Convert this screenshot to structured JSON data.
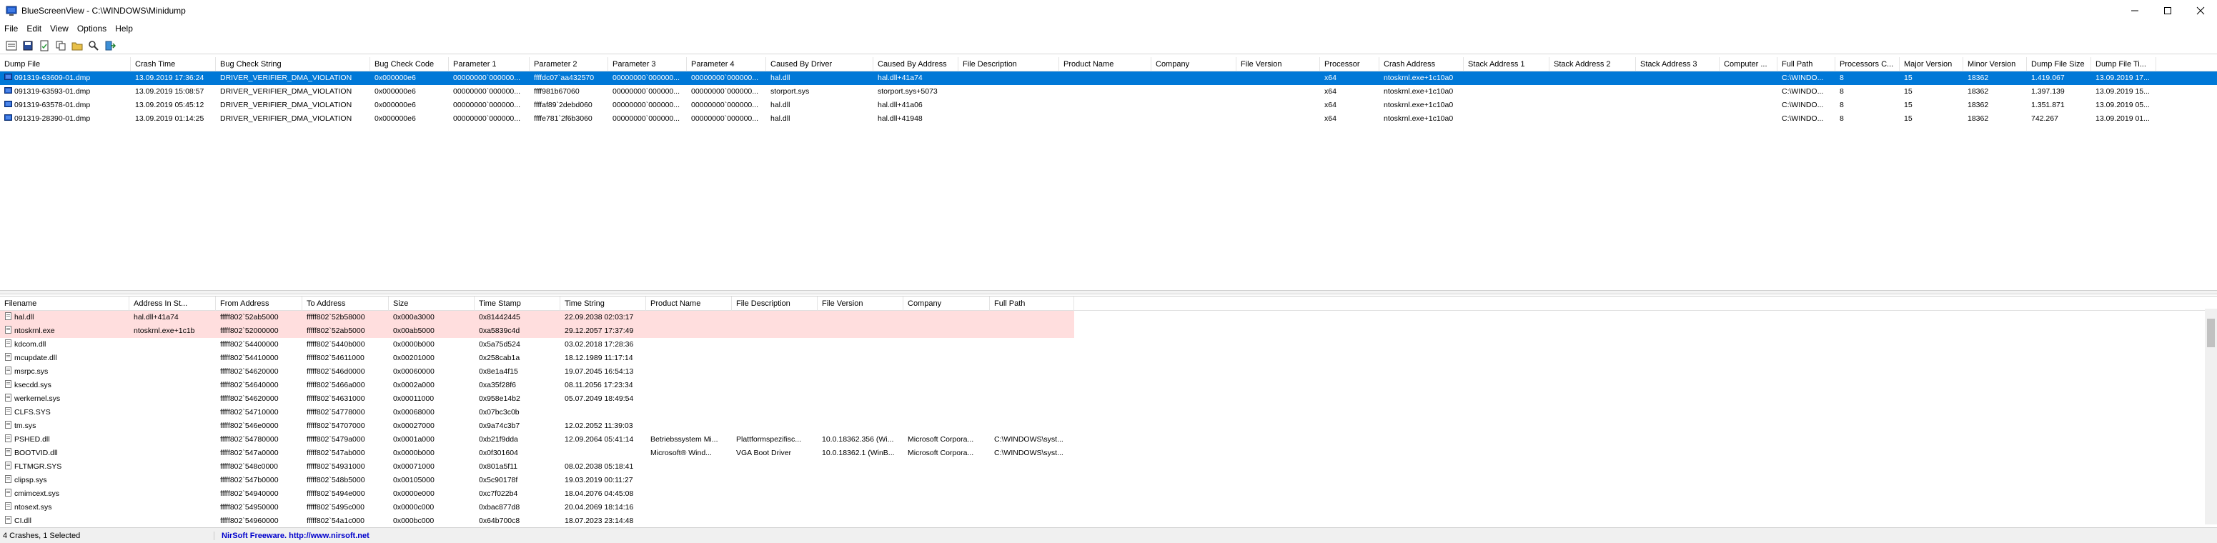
{
  "window": {
    "title": "BlueScreenView  -  C:\\WINDOWS\\Minidump"
  },
  "menu": [
    "File",
    "Edit",
    "View",
    "Options",
    "Help"
  ],
  "top_grid": {
    "columns": [
      "Dump File",
      "Crash Time",
      "Bug Check String",
      "Bug Check Code",
      "Parameter 1",
      "Parameter 2",
      "Parameter 3",
      "Parameter 4",
      "Caused By Driver",
      "Caused By Address",
      "File Description",
      "Product Name",
      "Company",
      "File Version",
      "Processor",
      "Crash Address",
      "Stack Address 1",
      "Stack Address 2",
      "Stack Address 3",
      "Computer ...",
      "Full Path",
      "Processors C...",
      "Major Version",
      "Minor Version",
      "Dump File Size",
      "Dump File Ti..."
    ],
    "rows": [
      [
        "091319-63609-01.dmp",
        "13.09.2019 17:36:24",
        "DRIVER_VERIFIER_DMA_VIOLATION",
        "0x000000e6",
        "00000000`000000...",
        "ffffdc07`aa432570",
        "00000000`000000...",
        "00000000`000000...",
        "hal.dll",
        "hal.dll+41a74",
        "",
        "",
        "",
        "",
        "x64",
        "ntoskrnl.exe+1c10a0",
        "",
        "",
        "",
        "",
        "C:\\WINDO...",
        "8",
        "15",
        "18362",
        "1.419.067",
        "13.09.2019 17..."
      ],
      [
        "091319-63593-01.dmp",
        "13.09.2019 15:08:57",
        "DRIVER_VERIFIER_DMA_VIOLATION",
        "0x000000e6",
        "00000000`000000...",
        "ffff981b67060",
        "00000000`000000...",
        "00000000`000000...",
        "storport.sys",
        "storport.sys+5073",
        "",
        "",
        "",
        "",
        "x64",
        "ntoskrnl.exe+1c10a0",
        "",
        "",
        "",
        "",
        "C:\\WINDO...",
        "8",
        "15",
        "18362",
        "1.397.139",
        "13.09.2019 15..."
      ],
      [
        "091319-63578-01.dmp",
        "13.09.2019 05:45:12",
        "DRIVER_VERIFIER_DMA_VIOLATION",
        "0x000000e6",
        "00000000`000000...",
        "ffffaf89`2debd060",
        "00000000`000000...",
        "00000000`000000...",
        "hal.dll",
        "hal.dll+41a06",
        "",
        "",
        "",
        "",
        "x64",
        "ntoskrnl.exe+1c10a0",
        "",
        "",
        "",
        "",
        "C:\\WINDO...",
        "8",
        "15",
        "18362",
        "1.351.871",
        "13.09.2019 05..."
      ],
      [
        "091319-28390-01.dmp",
        "13.09.2019 01:14:25",
        "DRIVER_VERIFIER_DMA_VIOLATION",
        "0x000000e6",
        "00000000`000000...",
        "ffffe781`2f6b3060",
        "00000000`000000...",
        "00000000`000000...",
        "hal.dll",
        "hal.dll+41948",
        "",
        "",
        "",
        "",
        "x64",
        "ntoskrnl.exe+1c10a0",
        "",
        "",
        "",
        "",
        "C:\\WINDO...",
        "8",
        "15",
        "18362",
        "742.267",
        "13.09.2019 01..."
      ]
    ]
  },
  "bottom_grid": {
    "columns": [
      "Filename",
      "Address In St...",
      "From Address",
      "To Address",
      "Size",
      "Time Stamp",
      "Time String",
      "Product Name",
      "File Description",
      "File Version",
      "Company",
      "Full Path"
    ],
    "rows": [
      [
        "hal.dll",
        "hal.dll+41a74",
        "fffff802`52ab5000",
        "fffff802`52b58000",
        "0x000a3000",
        "0x81442445",
        "22.09.2038 02:03:17",
        "",
        "",
        "",
        "",
        ""
      ],
      [
        "ntoskrnl.exe",
        "ntoskrnl.exe+1c1b",
        "fffff802`52000000",
        "fffff802`52ab5000",
        "0x00ab5000",
        "0xa5839c4d",
        "29.12.2057 17:37:49",
        "",
        "",
        "",
        "",
        ""
      ],
      [
        "kdcom.dll",
        "",
        "fffff802`54400000",
        "fffff802`5440b000",
        "0x0000b000",
        "0x5a75d524",
        "03.02.2018 17:28:36",
        "",
        "",
        "",
        "",
        ""
      ],
      [
        "mcupdate.dll",
        "",
        "fffff802`54410000",
        "fffff802`54611000",
        "0x00201000",
        "0x258cab1a",
        "18.12.1989 11:17:14",
        "",
        "",
        "",
        "",
        ""
      ],
      [
        "msrpc.sys",
        "",
        "fffff802`54620000",
        "fffff802`546d0000",
        "0x00060000",
        "0x8e1a4f15",
        "19.07.2045 16:54:13",
        "",
        "",
        "",
        "",
        ""
      ],
      [
        "ksecdd.sys",
        "",
        "fffff802`54640000",
        "fffff802`5466a000",
        "0x0002a000",
        "0xa35f28f6",
        "08.11.2056 17:23:34",
        "",
        "",
        "",
        "",
        ""
      ],
      [
        "werkernel.sys",
        "",
        "fffff802`54620000",
        "fffff802`54631000",
        "0x00011000",
        "0x958e14b2",
        "05.07.2049 18:49:54",
        "",
        "",
        "",
        "",
        ""
      ],
      [
        "CLFS.SYS",
        "",
        "fffff802`54710000",
        "fffff802`54778000",
        "0x00068000",
        "0x07bc3c0b",
        "",
        "",
        "",
        "",
        "",
        ""
      ],
      [
        "tm.sys",
        "",
        "fffff802`546e0000",
        "fffff802`54707000",
        "0x00027000",
        "0x9a74c3b7",
        "12.02.2052 11:39:03",
        "",
        "",
        "",
        "",
        ""
      ],
      [
        "PSHED.dll",
        "",
        "fffff802`54780000",
        "fffff802`5479a000",
        "0x0001a000",
        "0xb21f9dda",
        "12.09.2064 05:41:14",
        "Betriebssystem Mi...",
        "Plattformspezifisc...",
        "10.0.18362.356 (Wi...",
        "Microsoft Corpora...",
        "C:\\WINDOWS\\syst..."
      ],
      [
        "BOOTVID.dll",
        "",
        "fffff802`547a0000",
        "fffff802`547ab000",
        "0x0000b000",
        "0x0f301604",
        "",
        "Microsoft® Wind...",
        "VGA Boot Driver",
        "10.0.18362.1 (WinB...",
        "Microsoft Corpora...",
        "C:\\WINDOWS\\syst..."
      ],
      [
        "FLTMGR.SYS",
        "",
        "fffff802`548c0000",
        "fffff802`54931000",
        "0x00071000",
        "0x801a5f11",
        "08.02.2038 05:18:41",
        "",
        "",
        "",
        "",
        ""
      ],
      [
        "clipsp.sys",
        "",
        "fffff802`547b0000",
        "fffff802`548b5000",
        "0x00105000",
        "0x5c90178f",
        "19.03.2019 00:11:27",
        "",
        "",
        "",
        "",
        ""
      ],
      [
        "cmimcext.sys",
        "",
        "fffff802`54940000",
        "fffff802`5494e000",
        "0x0000e000",
        "0xc7f022b4",
        "18.04.2076 04:45:08",
        "",
        "",
        "",
        "",
        ""
      ],
      [
        "ntosext.sys",
        "",
        "fffff802`54950000",
        "fffff802`5495c000",
        "0x0000c000",
        "0xbac877d8",
        "20.04.2069 18:14:16",
        "",
        "",
        "",
        "",
        ""
      ],
      [
        "CI.dll",
        "",
        "fffff802`54960000",
        "fffff802`54a1c000",
        "0x000bc000",
        "0x64b700c8",
        "18.07.2023 23:14:48",
        "",
        "",
        "",
        "",
        ""
      ]
    ]
  },
  "status": {
    "count": "4 Crashes, 1 Selected",
    "link": "NirSoft Freeware.  http://www.nirsoft.net"
  }
}
